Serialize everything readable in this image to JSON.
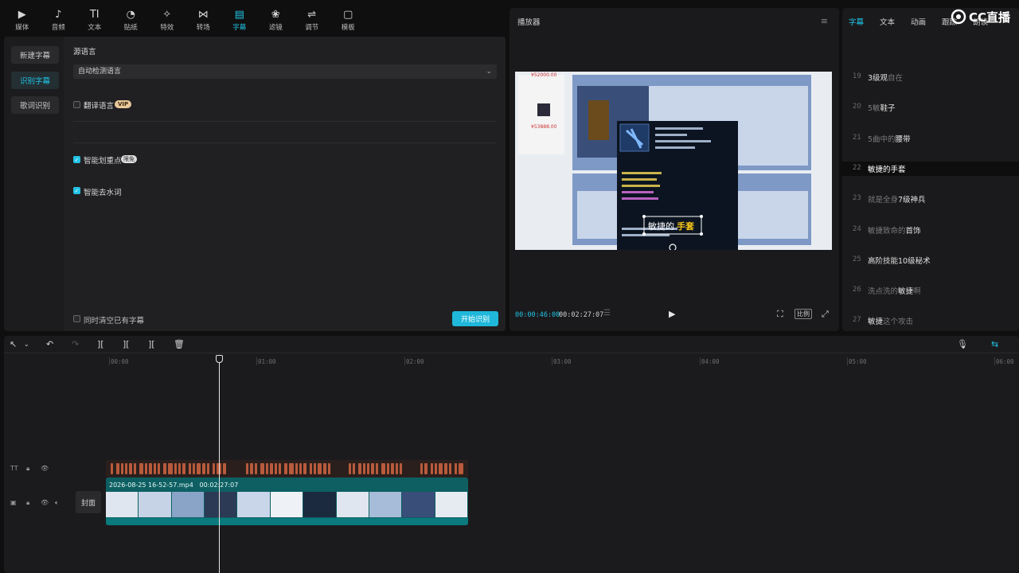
{
  "toolbar": {
    "items": [
      {
        "label": "媒体",
        "icon": "media-icon"
      },
      {
        "label": "音频",
        "icon": "audio-icon"
      },
      {
        "label": "文本",
        "icon": "text-icon"
      },
      {
        "label": "贴纸",
        "icon": "sticker-icon"
      },
      {
        "label": "特效",
        "icon": "effects-icon"
      },
      {
        "label": "转场",
        "icon": "transition-icon"
      },
      {
        "label": "字幕",
        "icon": "subtitle-icon",
        "active": true
      },
      {
        "label": "滤镜",
        "icon": "filter-icon"
      },
      {
        "label": "调节",
        "icon": "adjust-icon"
      },
      {
        "label": "模板",
        "icon": "template-icon"
      }
    ]
  },
  "left_panel": {
    "side_buttons": [
      "新建字幕",
      "识别字幕",
      "歌词识别"
    ],
    "active_side": "识别字幕",
    "source_language_label": "源语言",
    "source_language_value": "自动检测语言",
    "translate_label": "翻译语言",
    "vip_badge": "VIP",
    "smart_highlight_label": "智能划重点",
    "smart_highlight_badge": "限免",
    "smart_filler_label": "智能去水词",
    "clear_existing_label": "同时清空已有字幕",
    "start_button": "开始识别"
  },
  "player": {
    "title": "播放器",
    "current_time": "00:00:46:00",
    "total_time": "00:02:27:07",
    "ratio_label": "比例",
    "video_caption_a": "敏捷的",
    "video_caption_b": "手套",
    "video_price_1": "¥52000.00",
    "video_price_2": "¥53888.00"
  },
  "right_panel": {
    "tabs": [
      "字幕",
      "文本",
      "动画",
      "跟踪",
      "朗读"
    ],
    "active_tab": "字幕",
    "logo_text": "CC直播",
    "subtitles": [
      {
        "num": "19",
        "parts": [
          {
            "t": "3级观",
            "d": false
          },
          {
            "t": "自在",
            "d": true
          }
        ]
      },
      {
        "num": "20",
        "parts": [
          {
            "t": "5敏",
            "d": true
          },
          {
            "t": "鞋子",
            "d": false
          }
        ]
      },
      {
        "num": "21",
        "parts": [
          {
            "t": "5曲中的",
            "d": true
          },
          {
            "t": "腰带",
            "d": false
          }
        ]
      },
      {
        "num": "22",
        "parts": [
          {
            "t": "敏捷的手套",
            "d": false
          }
        ],
        "active": true
      },
      {
        "num": "23",
        "parts": [
          {
            "t": "就是全身",
            "d": true
          },
          {
            "t": "7级神兵",
            "d": false
          }
        ]
      },
      {
        "num": "24",
        "parts": [
          {
            "t": "敏捷致命的",
            "d": true
          },
          {
            "t": "首饰",
            "d": false
          }
        ]
      },
      {
        "num": "25",
        "parts": [
          {
            "t": "高阶技能10级秘术",
            "d": false
          }
        ]
      },
      {
        "num": "26",
        "parts": [
          {
            "t": "洗点洗的",
            "d": true
          },
          {
            "t": "敏捷",
            "d": false
          },
          {
            "t": "啊",
            "d": true
          }
        ]
      },
      {
        "num": "27",
        "parts": [
          {
            "t": "敏捷",
            "d": false
          },
          {
            "t": "这个攻击",
            "d": true
          }
        ]
      }
    ]
  },
  "timeline": {
    "ruler_labels": [
      "00:00",
      "01:00",
      "02:00",
      "03:00",
      "04:00",
      "05:00",
      "06:00"
    ],
    "clip_name": "2026-08-25 16-52-57.mp4",
    "clip_duration": "00:02:27:07",
    "cover_label": "封面"
  },
  "colors": {
    "accent": "#22c3e6",
    "panel": "#1c1c1e",
    "subtitle_segment": "#b85a3c",
    "video_track": "#0d5f62"
  }
}
